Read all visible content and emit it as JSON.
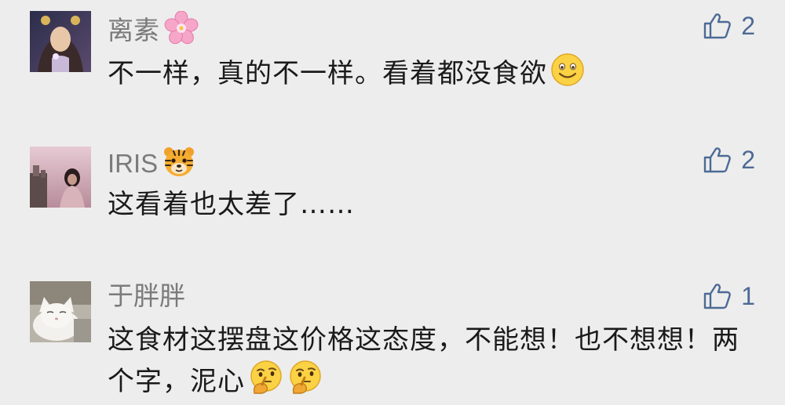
{
  "comments": [
    {
      "username": "离素",
      "username_emoji": "cherry-blossom-icon",
      "text": "不一样，真的不一样。看着都没食欲",
      "text_emoji": "smiling-face-icon",
      "likes": "2"
    },
    {
      "username": "IRIS",
      "username_emoji": "tiger-face-icon",
      "text": "这看着也太差了……",
      "likes": "2"
    },
    {
      "username": "于胖胖",
      "text": "这食材这摆盘这价格这态度，不能想！也不想想！两个字，泥心",
      "text_emojis": [
        "thinking-face-icon",
        "thinking-face-icon"
      ],
      "likes": "1"
    }
  ],
  "colors": {
    "background": "#ededed",
    "username": "#7b7b7b",
    "text": "#1a1a1a",
    "like": "#4d6a95"
  }
}
